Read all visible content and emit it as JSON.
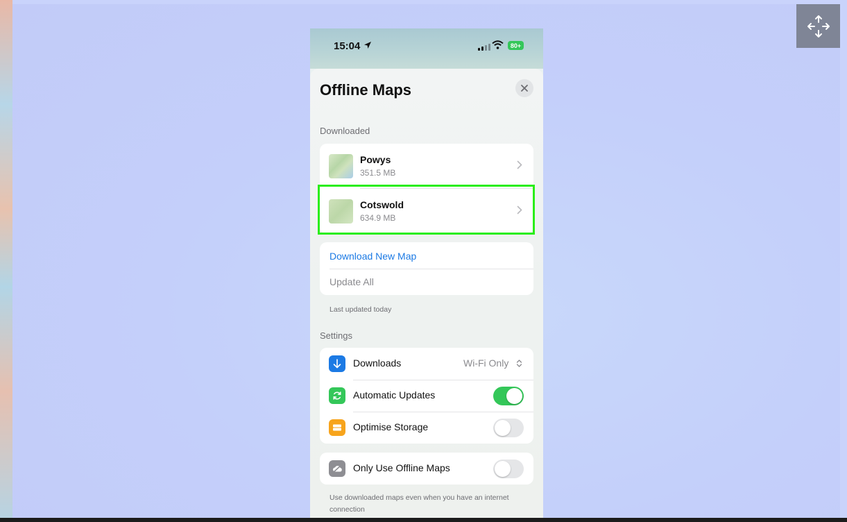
{
  "status_bar": {
    "time": "15:04",
    "battery": "80+"
  },
  "sheet": {
    "title": "Offline Maps",
    "downloaded_label": "Downloaded",
    "maps": [
      {
        "name": "Powys",
        "size": "351.5 MB"
      },
      {
        "name": "Cotswold",
        "size": "634.9 MB"
      }
    ],
    "actions": {
      "download_new": "Download New Map",
      "update_all": "Update All"
    },
    "last_updated": "Last updated today",
    "settings_label": "Settings",
    "settings": {
      "downloads": {
        "label": "Downloads",
        "value": "Wi-Fi Only"
      },
      "automatic_updates": {
        "label": "Automatic Updates",
        "enabled": true
      },
      "optimise_storage": {
        "label": "Optimise Storage",
        "enabled": false
      }
    },
    "offline_only": {
      "label": "Only Use Offline Maps",
      "enabled": false
    },
    "footnote": "Use downloaded maps even when you have an internet connection"
  },
  "colors": {
    "accent_blue": "#1c7ae4",
    "toggle_green": "#34c759",
    "highlight_green": "#2aee17",
    "storage_orange": "#f7a41c"
  },
  "icons": [
    "move-icon",
    "location-arrow-icon",
    "signal-icon",
    "wifi-icon",
    "close-icon",
    "chevron-right-icon",
    "download-arrow-icon",
    "refresh-icon",
    "storage-icon",
    "cloud-off-icon"
  ]
}
